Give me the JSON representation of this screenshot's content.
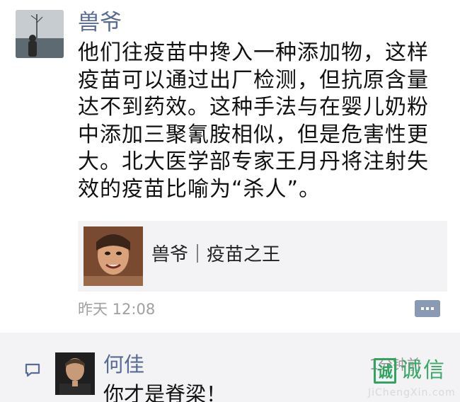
{
  "post": {
    "author": "兽爷",
    "text_lines": [
      "他们往疫苗中搀入一种添加物，这样",
      "疫苗可以通过出厂检测，但抗原含量",
      "达不到药效。这种手法与在婴儿奶粉",
      "中添加三聚氰胺相似，但是危害性更",
      "大。北大医学部专家王月丹将注射失",
      "效的疫苗比喻为“杀人”。"
    ],
    "share_card": {
      "title": "兽爷｜疫苗之王"
    },
    "timestamp": "昨天 12:08",
    "comment_button_icon": "more-dots-icon"
  },
  "comment": {
    "author": "何佳",
    "time": "1分钟前",
    "text": "你才是脊梁！"
  },
  "watermark": {
    "logo_char": "诚",
    "cn": "诚信",
    "en": "JiChengXin.com"
  },
  "colors": {
    "name_link": "#576b95",
    "body_text": "#111111",
    "meta_text": "#a0a0a0",
    "card_bg": "#f3f3f5",
    "watermark_green": "#3aa866"
  }
}
